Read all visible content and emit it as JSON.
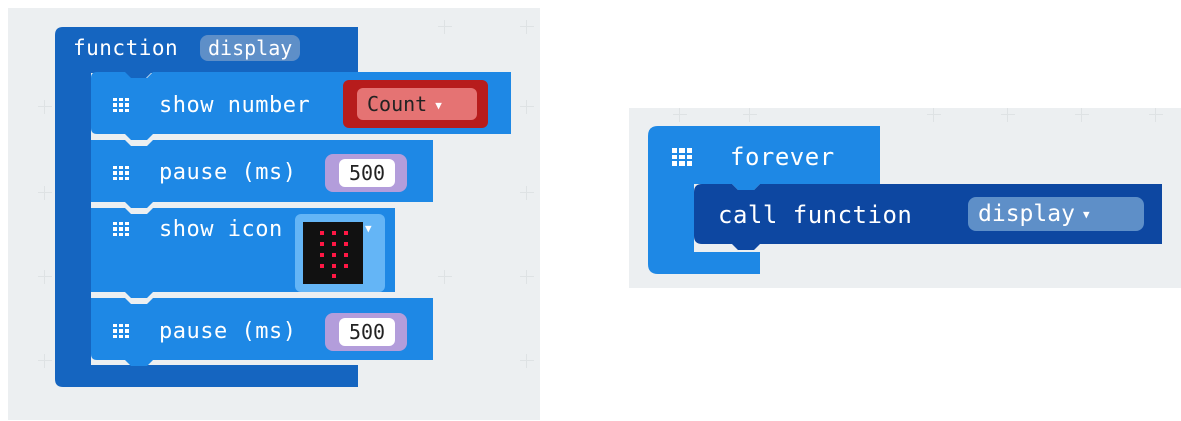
{
  "function_block": {
    "keyword": "function",
    "name": "display",
    "statements": [
      {
        "label": "show number",
        "variable": "Count",
        "dropdown_icon": "chevron-down-icon"
      },
      {
        "label": "pause (ms)",
        "value": "500"
      },
      {
        "label": "show icon",
        "icon": "led-grid-icon"
      },
      {
        "label": "pause (ms)",
        "value": "500"
      }
    ]
  },
  "forever_block": {
    "label": "forever",
    "call": {
      "label": "call function",
      "target": "display"
    }
  },
  "colors": {
    "workspace": "#eceff1",
    "function_block": "#1565c0",
    "basic_block": "#1e88e5",
    "call_block": "#0d47a1",
    "variable_block": "#b71c1c",
    "variable_pill": "#e57373",
    "math_block": "#b39ddb",
    "icon_block": "#64b5f6"
  }
}
